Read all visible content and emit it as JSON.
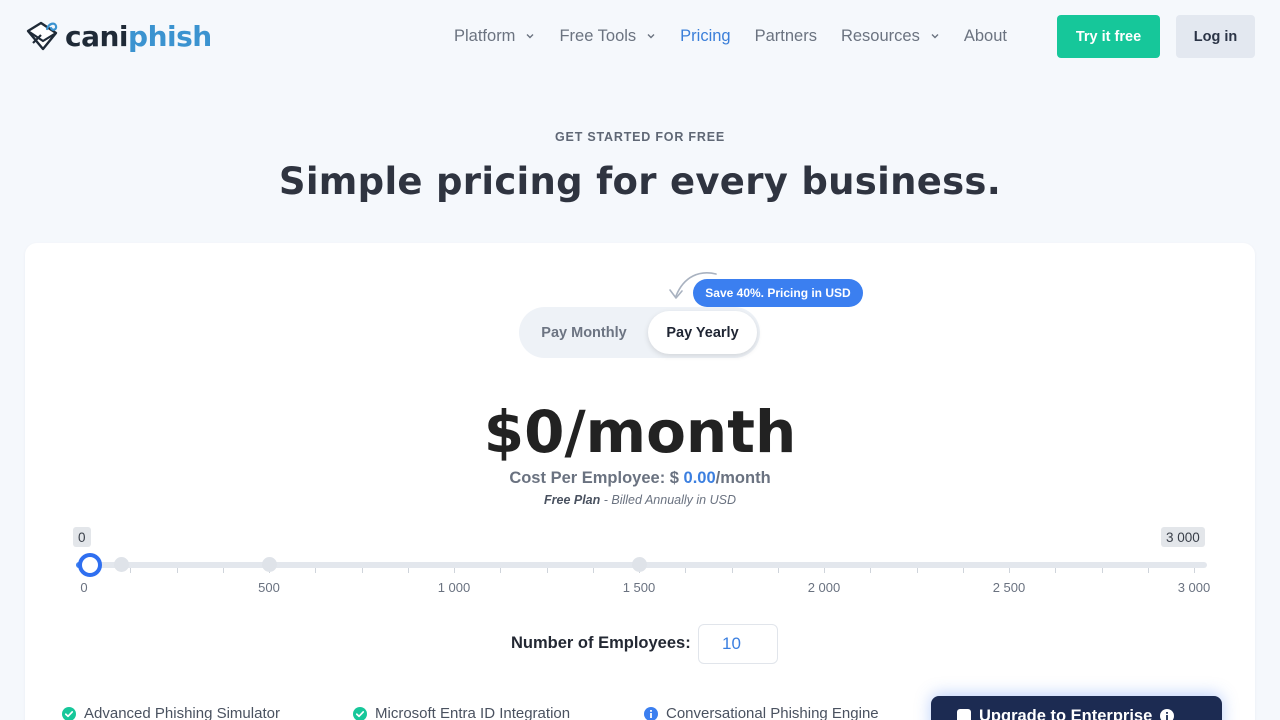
{
  "brand": {
    "part1": "cani",
    "part2": "phish"
  },
  "nav": {
    "items": [
      {
        "label": "Platform",
        "dropdown": true,
        "active": false
      },
      {
        "label": "Free Tools",
        "dropdown": true,
        "active": false
      },
      {
        "label": "Pricing",
        "dropdown": false,
        "active": true
      },
      {
        "label": "Partners",
        "dropdown": false,
        "active": false
      },
      {
        "label": "Resources",
        "dropdown": true,
        "active": false
      },
      {
        "label": "About",
        "dropdown": false,
        "active": false
      }
    ],
    "try_label": "Try it free",
    "login_label": "Log in"
  },
  "hero": {
    "eyebrow": "GET STARTED FOR FREE",
    "headline": "Simple pricing for every business."
  },
  "billing": {
    "save_badge": "Save 40%. Pricing in USD",
    "monthly_label": "Pay Monthly",
    "yearly_label": "Pay Yearly",
    "selected": "yearly"
  },
  "price": {
    "amount": "$0/month",
    "cost_prefix": "Cost Per Employee: $ ",
    "cost_value": "0.00",
    "cost_suffix": "/month",
    "plan_name": "Free Plan",
    "plan_note": " - Billed Annually in USD"
  },
  "slider": {
    "min_label": "0",
    "max_label": "3 000",
    "min": 0,
    "max": 3000,
    "value": 10,
    "tick_labels": [
      "0",
      "500",
      "1 000",
      "1 500",
      "2 000",
      "2 500",
      "3 000"
    ],
    "tier_marks": [
      100,
      500,
      1500
    ]
  },
  "employees": {
    "label": "Number of Employees:",
    "value": "10"
  },
  "features": [
    {
      "label": "Advanced Phishing Simulator",
      "icon": "check-circle-icon"
    },
    {
      "label": "Microsoft Entra ID Integration",
      "icon": "check-circle-icon"
    },
    {
      "label": "Conversational Phishing Engine",
      "icon": "info-circle-icon"
    }
  ],
  "enterprise": {
    "label": "Upgrade to Enterprise"
  },
  "colors": {
    "accent_green": "#16c79a",
    "accent_blue": "#3b7ff0",
    "navy": "#1c2b52"
  }
}
